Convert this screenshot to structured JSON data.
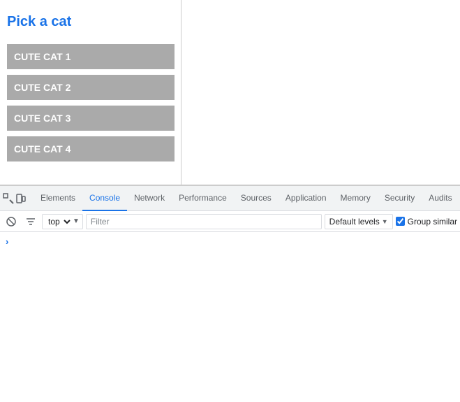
{
  "page": {
    "title": "Pick a cat"
  },
  "cats": [
    {
      "label": "CUTE CAT 1"
    },
    {
      "label": "CUTE CAT 2"
    },
    {
      "label": "CUTE CAT 3"
    },
    {
      "label": "CUTE CAT 4"
    }
  ],
  "devtools": {
    "tabs": [
      {
        "label": "Elements",
        "active": false
      },
      {
        "label": "Console",
        "active": true
      },
      {
        "label": "Network",
        "active": false
      },
      {
        "label": "Performance",
        "active": false
      },
      {
        "label": "Sources",
        "active": false
      },
      {
        "label": "Application",
        "active": false
      },
      {
        "label": "Memory",
        "active": false
      },
      {
        "label": "Security",
        "active": false
      },
      {
        "label": "Audits",
        "active": false
      }
    ],
    "console": {
      "context": "top",
      "filter_placeholder": "Filter",
      "levels_label": "Default levels",
      "group_similar_label": "Group similar",
      "group_similar_checked": true
    }
  }
}
